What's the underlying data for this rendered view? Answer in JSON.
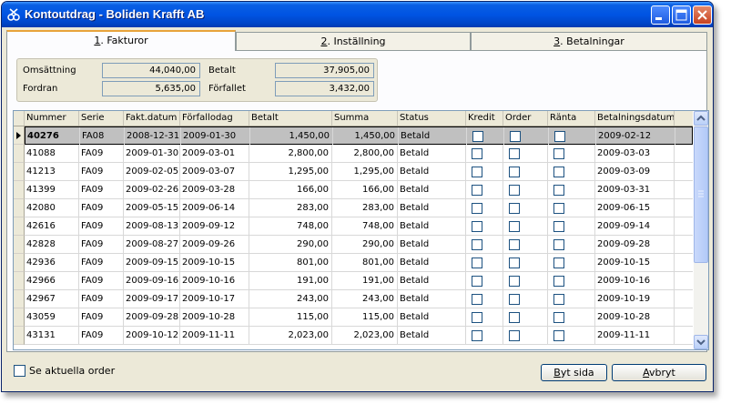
{
  "window": {
    "title": "Kontoutdrag - Boliden Krafft AB"
  },
  "tabs": [
    {
      "key": "1",
      "rest": ". Fakturor"
    },
    {
      "key": "2",
      "rest": ". Inställning"
    },
    {
      "key": "3",
      "rest": ". Betalningar"
    }
  ],
  "summary": {
    "omsattning_label": "Omsättning",
    "omsattning_value": "44,040,00",
    "betalt_label": "Betalt",
    "betalt_value": "37,905,00",
    "fordran_label": "Fordran",
    "fordran_value": "5,635,00",
    "forfallet_label": "Förfallet",
    "forfallet_value": "3,432,00"
  },
  "table": {
    "headers": [
      "Nummer",
      "Serie",
      "Fakt.datum",
      "Förfallodag",
      "Betalt",
      "Summa",
      "Status",
      "Kredit",
      "Order",
      "Ränta",
      "Betalningsdatum"
    ],
    "rows": [
      {
        "num": "40276",
        "serie": "FA08",
        "fakt": "2008-12-31",
        "forf": "2009-01-30",
        "betalt": "1,450,00",
        "summa": "1,450,00",
        "status": "Betald",
        "betdat": "2009-02-12"
      },
      {
        "num": "41088",
        "serie": "FA09",
        "fakt": "2009-01-30",
        "forf": "2009-03-01",
        "betalt": "2,800,00",
        "summa": "2,800,00",
        "status": "Betald",
        "betdat": "2009-03-03"
      },
      {
        "num": "41213",
        "serie": "FA09",
        "fakt": "2009-02-05",
        "forf": "2009-03-07",
        "betalt": "1,295,00",
        "summa": "1,295,00",
        "status": "Betald",
        "betdat": "2009-03-09"
      },
      {
        "num": "41399",
        "serie": "FA09",
        "fakt": "2009-02-26",
        "forf": "2009-03-28",
        "betalt": "166,00",
        "summa": "166,00",
        "status": "Betald",
        "betdat": "2009-03-31"
      },
      {
        "num": "42080",
        "serie": "FA09",
        "fakt": "2009-05-15",
        "forf": "2009-06-14",
        "betalt": "283,00",
        "summa": "283,00",
        "status": "Betald",
        "betdat": "2009-06-15"
      },
      {
        "num": "42616",
        "serie": "FA09",
        "fakt": "2009-08-13",
        "forf": "2009-09-12",
        "betalt": "748,00",
        "summa": "748,00",
        "status": "Betald",
        "betdat": "2009-09-14"
      },
      {
        "num": "42828",
        "serie": "FA09",
        "fakt": "2009-08-27",
        "forf": "2009-09-26",
        "betalt": "290,00",
        "summa": "290,00",
        "status": "Betald",
        "betdat": "2009-09-28"
      },
      {
        "num": "42936",
        "serie": "FA09",
        "fakt": "2009-09-15",
        "forf": "2009-10-15",
        "betalt": "801,00",
        "summa": "801,00",
        "status": "Betald",
        "betdat": "2009-10-15"
      },
      {
        "num": "42966",
        "serie": "FA09",
        "fakt": "2009-09-16",
        "forf": "2009-10-16",
        "betalt": "191,00",
        "summa": "191,00",
        "status": "Betald",
        "betdat": "2009-10-16"
      },
      {
        "num": "42967",
        "serie": "FA09",
        "fakt": "2009-09-17",
        "forf": "2009-10-17",
        "betalt": "243,00",
        "summa": "243,00",
        "status": "Betald",
        "betdat": "2009-10-19"
      },
      {
        "num": "43059",
        "serie": "FA09",
        "fakt": "2009-09-28",
        "forf": "2009-10-28",
        "betalt": "115,00",
        "summa": "115,00",
        "status": "Betald",
        "betdat": "2009-10-28"
      },
      {
        "num": "43131",
        "serie": "FA09",
        "fakt": "2009-10-12",
        "forf": "2009-11-11",
        "betalt": "2,023,00",
        "summa": "2,023,00",
        "status": "Betald",
        "betdat": "2009-11-11"
      }
    ]
  },
  "footer": {
    "checkbox_label": "Se aktuella order",
    "byt_key": "B",
    "byt_rest": "yt sida",
    "avbryt_key": "A",
    "avbryt_rest": "vbryt"
  }
}
